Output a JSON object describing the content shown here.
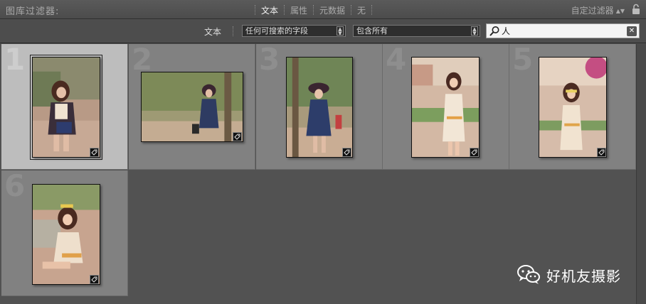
{
  "filter_bar": {
    "title": "图库过滤器:",
    "tabs": [
      {
        "label": "文本",
        "active": true
      },
      {
        "label": "属性",
        "active": false
      },
      {
        "label": "元数据",
        "active": false
      },
      {
        "label": "无",
        "active": false
      }
    ],
    "custom_filter_label": "自定过滤器",
    "lock_icon": "lock-icon"
  },
  "text_row": {
    "label": "文本",
    "field_select": "任何可搜索的字段",
    "rule_select": "包含所有",
    "search_value": "人",
    "search_icon": "magnifier-icon",
    "clear_icon": "clear-icon"
  },
  "grid": {
    "cells": [
      {
        "index": "1",
        "selected": true,
        "orientation": "portrait"
      },
      {
        "index": "2",
        "selected": false,
        "orientation": "landscape"
      },
      {
        "index": "3",
        "selected": false,
        "orientation": "portrait"
      },
      {
        "index": "4",
        "selected": false,
        "orientation": "portrait"
      },
      {
        "index": "5",
        "selected": false,
        "orientation": "portrait"
      },
      {
        "index": "6",
        "selected": false,
        "orientation": "portrait"
      }
    ],
    "badge_icon": "keyword-tag-icon"
  },
  "watermark": {
    "text": "好机友摄影",
    "icon": "wechat-icon"
  },
  "colors": {
    "panel_bg": "#505050",
    "cell_bg": "#818181",
    "cell_selected_bg": "#bdbdbd",
    "search_bg": "#f4f4f4"
  }
}
